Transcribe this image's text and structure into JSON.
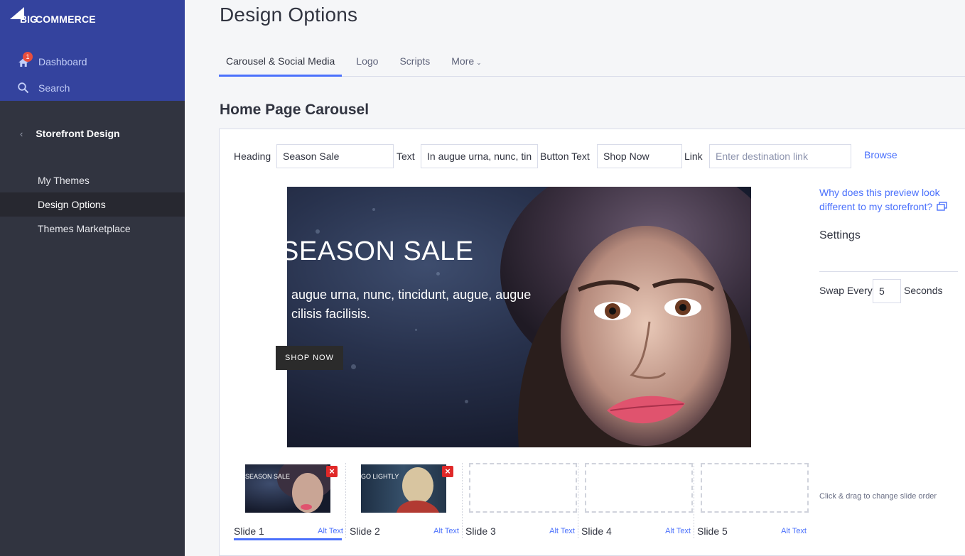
{
  "sidebar": {
    "logo_big": "BIG",
    "logo_commerce": "COMMERCE",
    "dashboard_label": "Dashboard",
    "dashboard_badge": "1",
    "search_label": "Search",
    "section_title": "Storefront Design",
    "items": [
      {
        "label": "My Themes",
        "active": false
      },
      {
        "label": "Design Options",
        "active": true
      },
      {
        "label": "Themes Marketplace",
        "active": false
      }
    ]
  },
  "page": {
    "title": "Design Options",
    "tabs": [
      {
        "label": "Carousel & Social Media",
        "active": true
      },
      {
        "label": "Logo",
        "active": false
      },
      {
        "label": "Scripts",
        "active": false
      },
      {
        "label": "More",
        "active": false
      }
    ],
    "carousel_heading": "Home Page Carousel"
  },
  "form": {
    "heading_label": "Heading",
    "heading_value": "Season Sale",
    "text_label": "Text",
    "text_value": "In augue urna, nunc, tin",
    "button_text_label": "Button Text",
    "button_text_value": "Shop Now",
    "link_label": "Link",
    "link_placeholder": "Enter destination link",
    "browse_label": "Browse"
  },
  "preview": {
    "heading": "SEASON SALE",
    "text_line1": " augue urna, nunc, tincidunt, augue, augue",
    "text_line2": "cilisis facilisis.",
    "button": "SHOP NOW"
  },
  "settings": {
    "why_link": "Why does this preview look different to my storefront?",
    "title": "Settings",
    "swap_label": "Swap Every",
    "swap_value": "5",
    "seconds_label": "Seconds"
  },
  "slides": [
    {
      "name": "Slide 1",
      "alt": "Alt Text",
      "thumb_title": "SEASON SALE",
      "active": true
    },
    {
      "name": "Slide 2",
      "alt": "Alt Text",
      "thumb_title": "GO LIGHTLY",
      "active": false
    },
    {
      "name": "Slide 3",
      "alt": "Alt Text",
      "active": false
    },
    {
      "name": "Slide 4",
      "alt": "Alt Text",
      "active": false
    },
    {
      "name": "Slide 5",
      "alt": "Alt Text",
      "active": false
    }
  ],
  "drag_hint": "Click & drag to change slide order",
  "colors": {
    "sidebar_top": "#34439e",
    "sidebar": "#313440",
    "accent": "#4b71fc",
    "delete": "#e02828"
  }
}
